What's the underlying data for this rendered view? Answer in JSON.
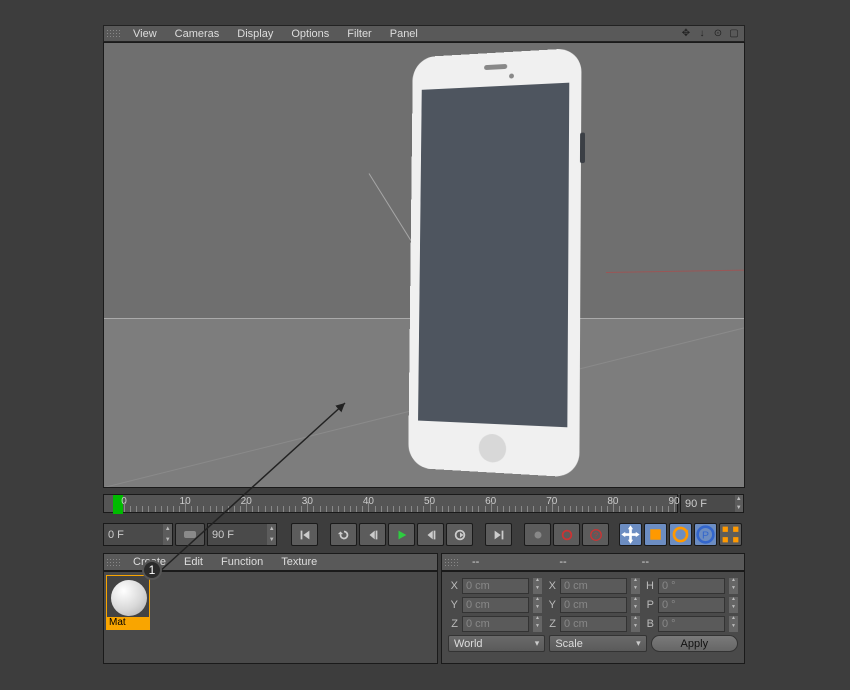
{
  "top_menu": {
    "items": [
      "View",
      "Cameras",
      "Display",
      "Options",
      "Filter",
      "Panel"
    ]
  },
  "timeline": {
    "start_field": "0 F",
    "end_field": "90 F",
    "left_field": "0 F",
    "right_field": "90 F",
    "labels": [
      "0",
      "10",
      "20",
      "30",
      "40",
      "50",
      "60",
      "70",
      "80",
      "90"
    ]
  },
  "material_menu": {
    "items": [
      "Create",
      "Edit",
      "Function",
      "Texture"
    ]
  },
  "material": {
    "name": "Mat"
  },
  "callout": {
    "number": "1"
  },
  "coord": {
    "header": {
      "col1": "--",
      "col2": "--",
      "col3": "--"
    },
    "rows": [
      {
        "axis": "X",
        "pos": "0 cm",
        "size_label": "X",
        "size": "0 cm",
        "rot_label": "H",
        "rot": "0 °"
      },
      {
        "axis": "Y",
        "pos": "0 cm",
        "size_label": "Y",
        "size": "0 cm",
        "rot_label": "P",
        "rot": "0 °"
      },
      {
        "axis": "Z",
        "pos": "0 cm",
        "size_label": "Z",
        "size": "0 cm",
        "rot_label": "B",
        "rot": "0 °"
      }
    ],
    "dd1": "World",
    "dd2": "Scale",
    "apply": "Apply"
  }
}
